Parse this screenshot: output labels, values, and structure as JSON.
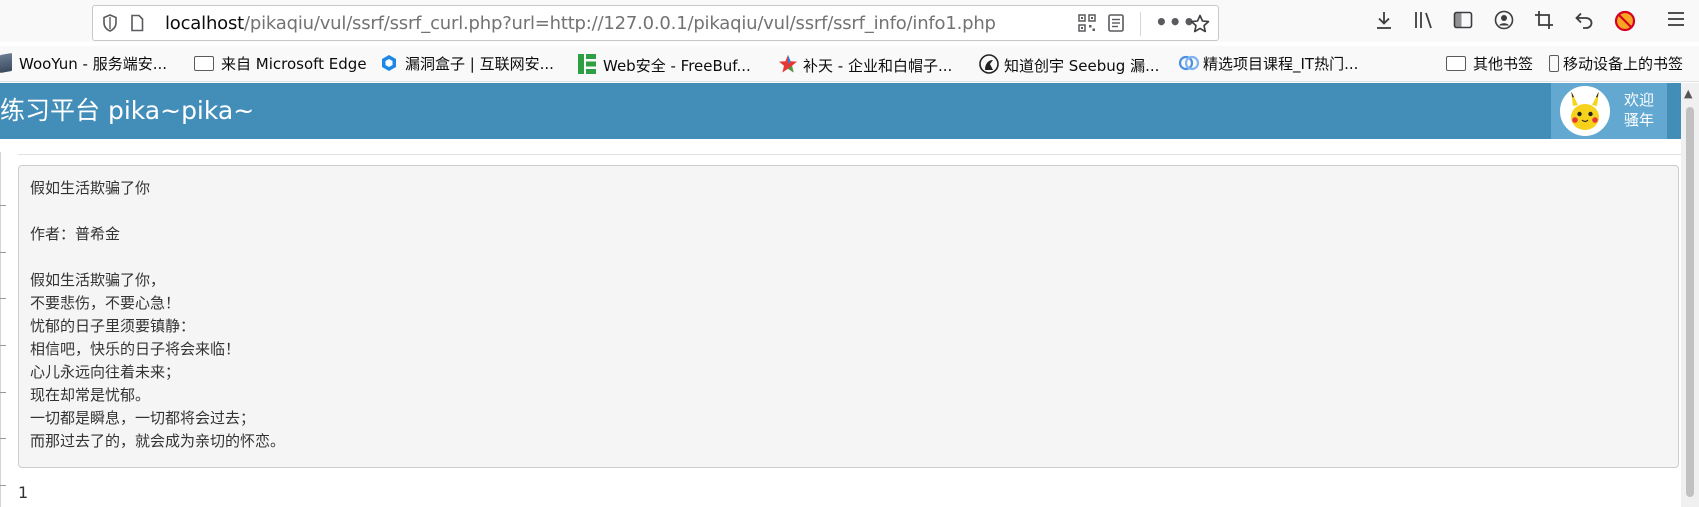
{
  "browser": {
    "url_host": "localhost",
    "url_path": "/pikaqiu/vul/ssrf/ssrf_curl.php?url=http://127.0.0.1/pikaqiu/vul/ssrf/ssrf_info/info1.php",
    "icons": [
      "shield-icon",
      "page-info-icon",
      "qr-code-icon",
      "reader-view-icon",
      "more-icon",
      "bookmark-star-icon",
      "download-icon",
      "library-icon",
      "sidebar-icon",
      "account-icon",
      "screenshot-icon",
      "back-icon",
      "blocker-icon",
      "menu-icon"
    ]
  },
  "bookmarks": [
    {
      "label": "WooYun - 服务端安...",
      "icon": "wooyun-icon"
    },
    {
      "label": "来自 Microsoft Edge",
      "icon": "folder-icon"
    },
    {
      "label": "漏洞盒子 | 互联网安...",
      "icon": "vulbox-icon"
    },
    {
      "label": "Web安全 - FreeBuf...",
      "icon": "freebuf-icon"
    },
    {
      "label": "补天 - 企业和白帽子...",
      "icon": "butian-icon"
    },
    {
      "label": "知道创宇 Seebug 漏...",
      "icon": "seebug-icon"
    },
    {
      "label": "精选项目课程_IT热门...",
      "icon": "course-icon"
    }
  ],
  "bookmarks_right": [
    {
      "label": "其他书签",
      "icon": "folder-icon"
    },
    {
      "label": "移动设备上的书签",
      "icon": "mobile-icon"
    }
  ],
  "header": {
    "title": "练习平台 pika~pika~",
    "greeting_line1": "欢迎",
    "greeting_line2": "骚年"
  },
  "poem": {
    "lines": [
      "假如生活欺骗了你",
      "",
      "作者：普希金",
      "",
      "假如生活欺骗了你，",
      "不要悲伤，不要心急！",
      "忧郁的日子里须要镇静：",
      "相信吧，快乐的日子将会来临！",
      "心儿永远向往着未来；",
      "现在却常是忧郁。",
      "一切都是瞬息，一切都将会过去；",
      "而那过去了的，就会成为亲切的怀恋。"
    ]
  },
  "footer_count": "1",
  "colors": {
    "header_bg": "#438eb9",
    "user_box_bg": "#62a8d1",
    "poem_box_bg": "#f5f5f5"
  }
}
